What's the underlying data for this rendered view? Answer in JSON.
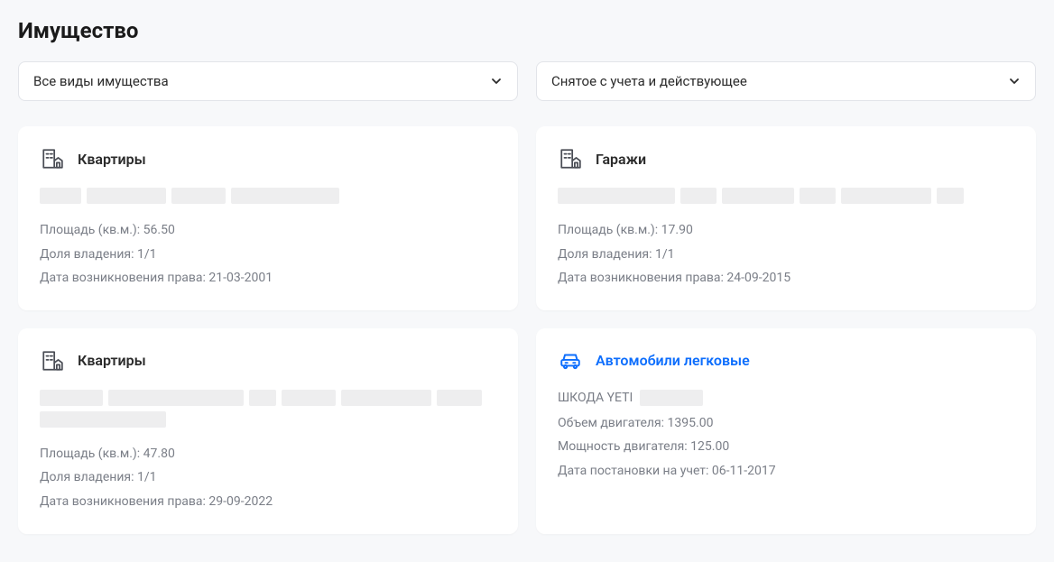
{
  "page_title": "Имущество",
  "filters": {
    "type": "Все виды имущества",
    "status": "Снятое с учета и действующее"
  },
  "cards": [
    {
      "title": "Квартиры",
      "icon": "building",
      "highlight": false,
      "rows": [
        {
          "label": "Площадь (кв.м.):",
          "value": "56.50"
        },
        {
          "label": "Доля владения:",
          "value": "1/1"
        },
        {
          "label": "Дата возникновения права:",
          "value": "21-03-2001"
        }
      ]
    },
    {
      "title": "Гаражи",
      "icon": "building",
      "highlight": false,
      "rows": [
        {
          "label": "Площадь (кв.м.):",
          "value": "17.90"
        },
        {
          "label": "Доля владения:",
          "value": "1/1"
        },
        {
          "label": "Дата возникновения права:",
          "value": "24-09-2015"
        }
      ]
    },
    {
      "title": "Квартиры",
      "icon": "building",
      "highlight": false,
      "rows": [
        {
          "label": "Площадь (кв.м.):",
          "value": "47.80"
        },
        {
          "label": "Доля владения:",
          "value": "1/1"
        },
        {
          "label": "Дата возникновения права:",
          "value": "29-09-2022"
        }
      ]
    },
    {
      "title": "Автомобили легковые",
      "icon": "car",
      "highlight": true,
      "name_prefix": "ШКОДА YETI",
      "rows": [
        {
          "label": "Объем двигателя:",
          "value": "1395.00"
        },
        {
          "label": "Мощность двигателя:",
          "value": "125.00"
        },
        {
          "label": "Дата постановки на учет:",
          "value": "06-11-2017"
        }
      ]
    }
  ]
}
